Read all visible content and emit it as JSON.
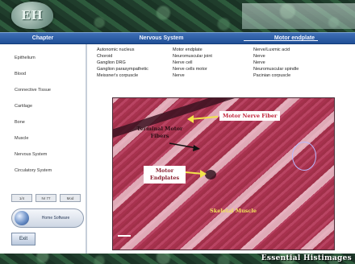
{
  "banner": {
    "logo_text": "EH"
  },
  "header": {
    "chapter": "Chapter",
    "section": "Nervous System",
    "topic": "Motor endplate"
  },
  "sidebar": {
    "items": [
      {
        "label": "Epithelium"
      },
      {
        "label": "Blood"
      },
      {
        "label": "Connective Tissue"
      },
      {
        "label": "Cartilage"
      },
      {
        "label": "Bone"
      },
      {
        "label": "Muscle"
      },
      {
        "label": "Nervous System"
      },
      {
        "label": "Circulatory System"
      }
    ],
    "nav": [
      "1/4",
      "Nr 77",
      "Mod"
    ],
    "home_label": "Home Software",
    "exit_label": "Exit"
  },
  "terms": {
    "col1": [
      "Autonomic nucleus",
      "Choroid",
      "Ganglion DRG",
      "Ganglion parasympathetic",
      "Meissner's corpuscle"
    ],
    "col2": [
      "Motor endplate",
      "Neuromuscular joint",
      "Nerve cell",
      "Nerve cells motor",
      "Nerve"
    ],
    "col3": [
      "Nerve/Luxmic acid",
      "Nerve",
      "Nerve",
      "Neuromuscular spindle",
      "Pacinian corpuscle"
    ]
  },
  "figure": {
    "label_motor_nerve": "Motor Nerve Fiber",
    "label_trans_fibers": "Terminal Motor Fibers",
    "label_endplate": "Motor Endplates",
    "label_skeletal": "Skeletal Muscle"
  },
  "footer": {
    "brand": "Essential Histimages"
  }
}
